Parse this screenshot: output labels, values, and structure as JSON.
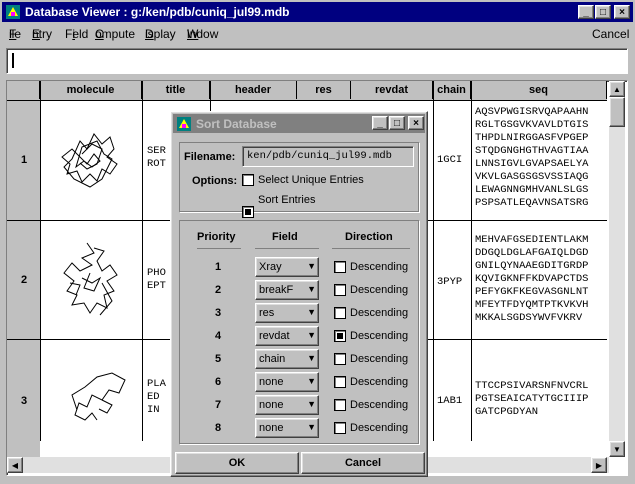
{
  "window": {
    "title": "Database Viewer : g:/ken/pdb/cuniq_jul99.mdb"
  },
  "menu": [
    {
      "label": "File",
      "key": "F"
    },
    {
      "label": "Entry",
      "key": "E"
    },
    {
      "label": "Field",
      "key": "F"
    },
    {
      "label": "Compute",
      "key": "C"
    },
    {
      "label": "Display",
      "key": "D"
    },
    {
      "label": "Window",
      "key": "W"
    }
  ],
  "cancel_label": "Cancel",
  "command_input": {
    "value": ""
  },
  "table": {
    "columns": [
      "molecule",
      "title",
      "header",
      "res",
      "revdat",
      "chain",
      "seq"
    ],
    "rows": [
      {
        "num": "1",
        "title": "SER\nROT",
        "chain": "1GCI",
        "seq": "AQSVPWGISRVQAPAAHN\nRGLTGSGVKVAVLDTGIS\nTHPDLNIRGGASFVPGEP\nSTQDGNGHGTHVAGTIAA\nLNNSIGVLGVAPSAELYA\nVKVLGASGSGSVSSIAQG\nLEWAGNNGMHVANLSLGS\nPSPSATLEQAVNSATSRG"
      },
      {
        "num": "2",
        "title": "PHO\nEPT",
        "chain": "3PYP",
        "seq": "MEHVAFGSEDIENTLAKM\nDDGQLDGLAFGAIQLDGD\nGNILQYNAAEGDITGRDP\nKQVIGKNFFKDVAPCTDS\nPEFYGKFKEGVASGNLNT\nMFEYTFDYQMTPTKVKVH\nMKKALSGDSYWVFVKRV"
      },
      {
        "num": "3",
        "title": "PLA\nED\nIN",
        "chain": "1AB1",
        "seq": "TTCCPSIVARSNFNVCRL\nPGTSEAICATYTGCIIIP\nGATCPGDYAN"
      }
    ]
  },
  "dialog": {
    "title": "Sort Database",
    "filename_label": "Filename:",
    "filename": "ken/pdb/cuniq_jul99.mdb",
    "options_label": "Options:",
    "unique_label": "Select Unique Entries",
    "unique_checked": false,
    "sort_label": "Sort Entries",
    "sort_checked": true,
    "headers": {
      "priority": "Priority",
      "field": "Field",
      "direction": "Direction"
    },
    "rows": [
      {
        "p": "1",
        "field": "Xray",
        "dir": "Descending",
        "checked": false
      },
      {
        "p": "2",
        "field": "breakF",
        "dir": "Descending",
        "checked": false
      },
      {
        "p": "3",
        "field": "res",
        "dir": "Descending",
        "checked": false
      },
      {
        "p": "4",
        "field": "revdat",
        "dir": "Descending",
        "checked": true
      },
      {
        "p": "5",
        "field": "chain",
        "dir": "Descending",
        "checked": false
      },
      {
        "p": "6",
        "field": "none",
        "dir": "Descending",
        "checked": false
      },
      {
        "p": "7",
        "field": "none",
        "dir": "Descending",
        "checked": false
      },
      {
        "p": "8",
        "field": "none",
        "dir": "Descending",
        "checked": false
      }
    ],
    "ok_label": "OK",
    "cancel_label": "Cancel"
  }
}
